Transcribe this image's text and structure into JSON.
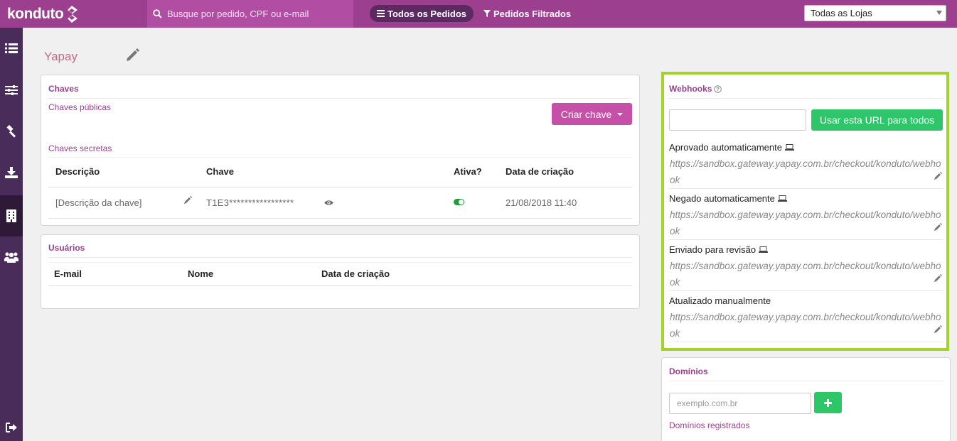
{
  "app": {
    "logo_text": "konduto"
  },
  "topbar": {
    "search_placeholder": "Busque por pedido, CPF ou e-mail",
    "tab_all": "Todos os Pedidos",
    "tab_filtered": "Pedidos Filtrados",
    "store_select": "Todas as Lojas"
  },
  "sidebar": {
    "items": [
      "list-icon",
      "sliders-icon",
      "gavel-icon",
      "download-icon",
      "building-icon",
      "users-icon"
    ],
    "active_index": 4,
    "bottom": "sign-out-icon"
  },
  "page": {
    "title": "Yapay"
  },
  "chaves": {
    "heading": "Chaves",
    "public_label": "Chaves públicas",
    "create_button": "Criar chave",
    "secret_label": "Chaves secretas",
    "columns": [
      "Descrição",
      "Chave",
      "Ativa?",
      "Data de criação"
    ],
    "rows": [
      {
        "description": "[Descrição da chave]",
        "key": "T1E3*****************",
        "active": true,
        "created": "21/08/2018 11:40"
      }
    ]
  },
  "usuarios": {
    "heading": "Usuários",
    "columns": [
      "E-mail",
      "Nome",
      "Data de criação"
    ]
  },
  "webhooks": {
    "heading": "Webhooks",
    "url_value": "",
    "apply_all_button": "Usar esta URL para todos",
    "items": [
      {
        "label": "Aprovado automaticamente",
        "url": "https://sandbox.gateway.yapay.com.br/checkout/konduto/webhook",
        "icon": "laptop-icon"
      },
      {
        "label": "Negado automaticamente",
        "url": "https://sandbox.gateway.yapay.com.br/checkout/konduto/webhook",
        "icon": "laptop-icon"
      },
      {
        "label": "Enviado para revisão",
        "url": "https://sandbox.gateway.yapay.com.br/checkout/konduto/webhook",
        "icon": "laptop-icon"
      },
      {
        "label": "Atualizado manualmente",
        "url": "https://sandbox.gateway.yapay.com.br/checkout/konduto/webhook",
        "icon": ""
      }
    ]
  },
  "dominios": {
    "heading": "Domínios",
    "input_placeholder": "exemplo.com.br",
    "add_button": "+",
    "registered_label": "Domínios registrados"
  },
  "colors": {
    "brand": "#9c3f8f",
    "sidebar": "#4a2c5a",
    "highlight_border": "#a5d22a",
    "success": "#2dc76a",
    "create_button": "#c64fa8"
  }
}
